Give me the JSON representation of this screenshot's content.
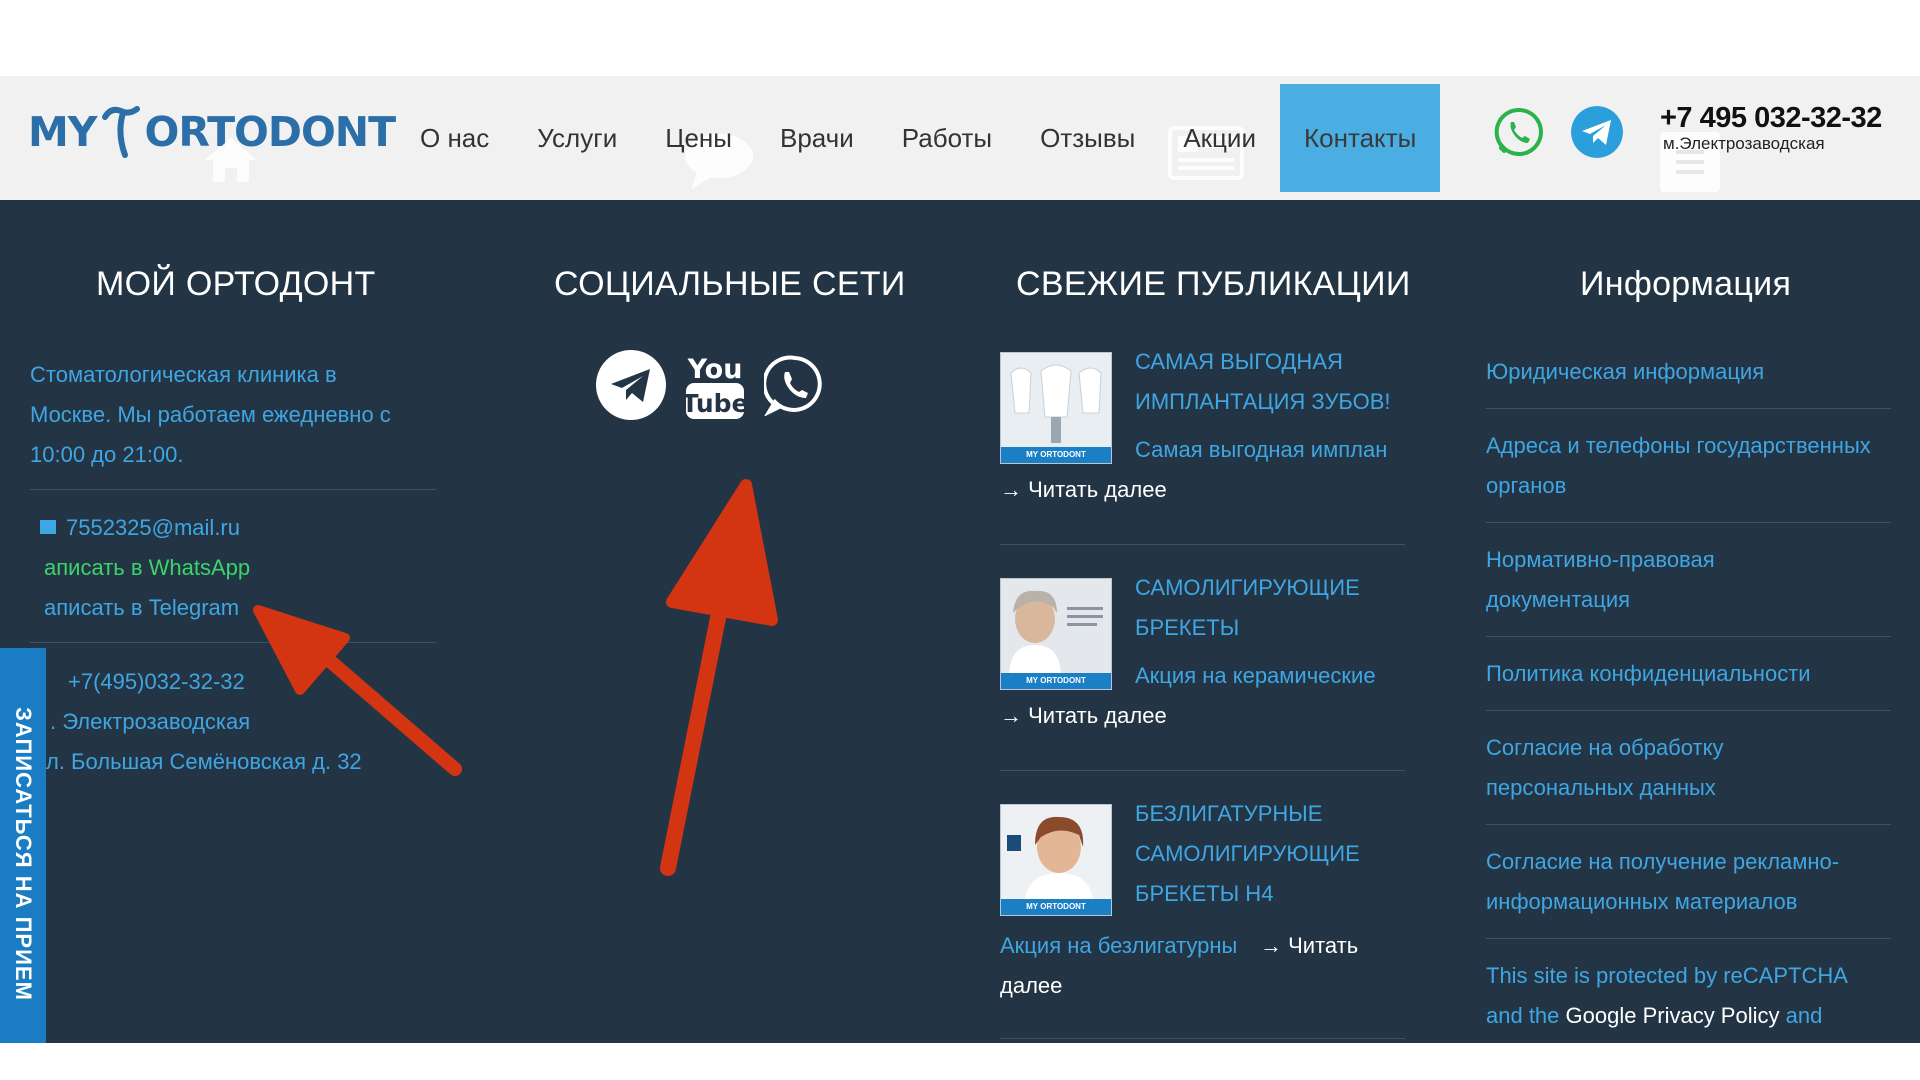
{
  "header": {
    "logo_left": "MY",
    "logo_right": "ORTODONT",
    "nav": [
      "О нас",
      "Услуги",
      "Цены",
      "Врачи",
      "Работы",
      "Отзывы",
      "Акции",
      "Контакты"
    ],
    "phone": "+7 495 032-32-32",
    "metro": "м.Электрозаводская"
  },
  "footer": {
    "col1": {
      "title": "МОЙ ОРТОДОНТ",
      "about_1": "Стоматологическая клиника в",
      "about_2": "Москве. Мы работаем ежедневно с",
      "about_3": "10:00 до 21:00.",
      "email": "7552325@mail.ru",
      "whatsapp": "аписать в WhatsApp",
      "telegram": "аписать в Telegram",
      "phone": "+7(495)032-32-32",
      "metro": ". Электрозаводская",
      "address": "л. Большая Семёновская д. 32"
    },
    "col2": {
      "title": "СОЦИАЛЬНЫЕ СЕТИ",
      "youtube_top": "You",
      "youtube_bottom": "Tube"
    },
    "col3": {
      "title": "СВЕЖИЕ ПУБЛИКАЦИИ",
      "posts": [
        {
          "title_1": "САМАЯ ВЫГОДНАЯ",
          "title_2": "ИМПЛАНТАЦИЯ ЗУБОВ!",
          "excerpt": "Самая выгодная имплан",
          "more": "→ Читать далее"
        },
        {
          "title_1": "САМОЛИГИРУЮЩИЕ",
          "title_2": "БРЕКЕТЫ",
          "excerpt": "Акция на керамические",
          "more": "→ Читать далее"
        },
        {
          "title_1": "БЕЗЛИГАТУРНЫЕ",
          "title_2": "САМОЛИГИРУЮЩИЕ",
          "title_3": "БРЕКЕТЫ H4",
          "excerpt": "Акция на безлигатурны",
          "more_1": "→ Читать",
          "more_2": "далее"
        }
      ],
      "thumb_label": "MY ORTODONT"
    },
    "col4": {
      "title": "Информация",
      "items": [
        "Юридическая информация",
        "Адреса и телефоны государственных",
        "органов",
        "Нормативно-правовая",
        "документация",
        "Политика конфиденциальности",
        "Согласие на обработку",
        "персональных данных",
        "Согласие на получение рекламно-",
        "информационных материалов"
      ],
      "recaptcha_1": "This site is protected by reCAPTCHA",
      "recaptcha_2a": "and the ",
      "recaptcha_2b": "Google Privacy Policy",
      "recaptcha_2c": " and"
    },
    "side_tab": "ЗАПИСАТЬСЯ НА ПРИЕМ"
  },
  "colors": {
    "footer_bg": "#233444",
    "link": "#3fa6e4",
    "accent": "#4aaee3",
    "arrow": "#d33512",
    "whatsapp": "#3bd46b"
  },
  "icons": [
    "home-icon",
    "speech-bubble-icon",
    "newspaper-icon",
    "menu-icon",
    "whatsapp-icon",
    "telegram-icon",
    "youtube-icon",
    "email-icon",
    "arrow-annotation"
  ]
}
